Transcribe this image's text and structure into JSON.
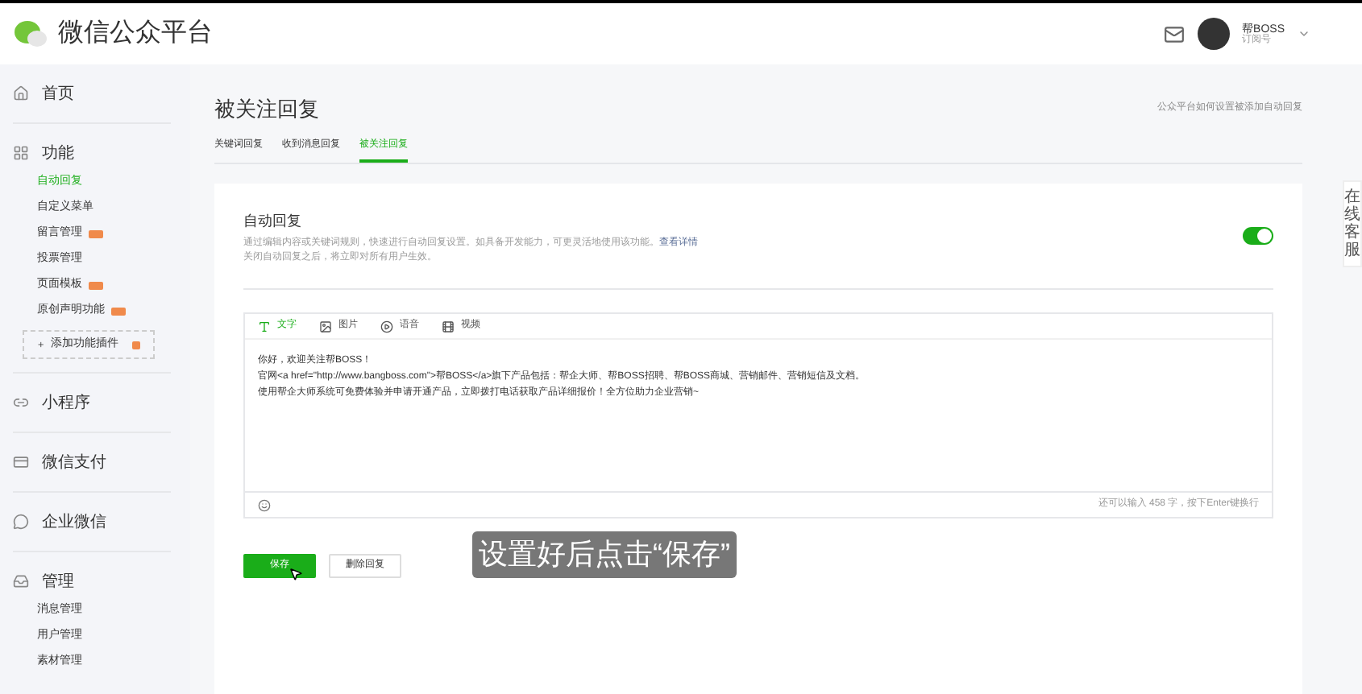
{
  "header": {
    "brand": "微信公众平台",
    "account_name": "帮BOSS",
    "account_type": "订阅号"
  },
  "sidebar": {
    "sections": [
      {
        "kind": "home",
        "label": "首页"
      },
      {
        "kind": "grid",
        "label": "功能",
        "items": [
          {
            "label": "自动回复",
            "selected": true,
            "new": false
          },
          {
            "label": "自定义菜单",
            "selected": false,
            "new": false
          },
          {
            "label": "留言管理",
            "selected": false,
            "new": true
          },
          {
            "label": "投票管理",
            "selected": false,
            "new": false
          },
          {
            "label": "页面模板",
            "selected": false,
            "new": true
          },
          {
            "label": "原创声明功能",
            "selected": false,
            "new": true
          }
        ],
        "add_plugin": {
          "label": "添加功能插件",
          "new": true
        }
      },
      {
        "kind": "link",
        "label": "小程序"
      },
      {
        "kind": "pay",
        "label": "微信支付"
      },
      {
        "kind": "chat",
        "label": "企业微信"
      },
      {
        "kind": "box",
        "label": "管理",
        "items": [
          {
            "label": "消息管理",
            "selected": false,
            "new": false
          },
          {
            "label": "用户管理",
            "selected": false,
            "new": false
          },
          {
            "label": "素材管理",
            "selected": false,
            "new": false
          }
        ]
      }
    ]
  },
  "page": {
    "title": "被关注回复",
    "help_link": "公众平台如何设置被添加自动回复",
    "tabs": [
      {
        "label": "关键词回复",
        "selected": false
      },
      {
        "label": "收到消息回复",
        "selected": false
      },
      {
        "label": "被关注回复",
        "selected": true
      }
    ]
  },
  "auto_reply": {
    "title": "自动回复",
    "description": "通过编辑内容或关键词规则，快速进行自动回复设置。如具备开发能力，可更灵活地使用该功能。",
    "details_link": "查看详情",
    "note": "关闭自动回复之后，将立即对所有用户生效。",
    "on": true
  },
  "editor": {
    "tabs": [
      {
        "kind": "text",
        "label": "文字",
        "selected": true
      },
      {
        "kind": "image",
        "label": "图片",
        "selected": false
      },
      {
        "kind": "voice",
        "label": "语音",
        "selected": false
      },
      {
        "kind": "video",
        "label": "视频",
        "selected": false
      }
    ],
    "lines": [
      "你好，欢迎关注帮BOSS！",
      "官网<a href=\"http://www.bangboss.com\">帮BOSS</a>旗下产品包括：帮企大师、帮BOSS招聘、帮BOSS商城、营销邮件、营销短信及文档。",
      "使用帮企大师系统可免费体验并申请开通产品，立即拨打电话获取产品详细报价！全方位助力企业营销~"
    ],
    "counter": "还可以输入 458 字，按下Enter键换行"
  },
  "buttons": [
    {
      "kind": "primary",
      "label": "保存"
    },
    {
      "kind": "default",
      "label": "删除回复"
    }
  ],
  "caption": "设置好后点击“保存”",
  "side_tab": "在线客服"
}
